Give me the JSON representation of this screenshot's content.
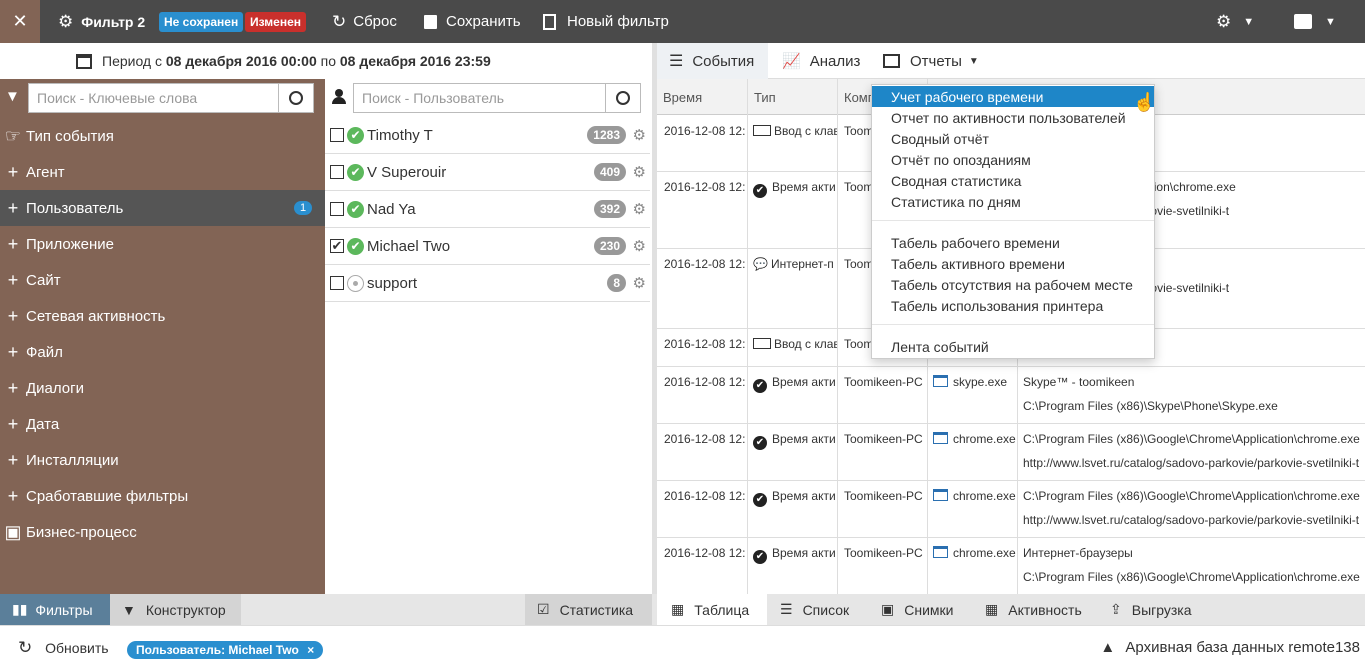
{
  "topbar": {
    "filter_name": "Фильтр 2",
    "badge_unsaved": "Не сохранен",
    "badge_changed": "Изменен",
    "reset_label": "Сброс",
    "save_label": "Сохранить",
    "new_filter_label": "Новый фильтр",
    "badge_unsaved_color": "#2a8fcf",
    "badge_changed_color": "#c9302c"
  },
  "period": {
    "prefix": "Период с",
    "from": "08 декабря 2016 00:00",
    "mid": "по",
    "to": "08 декабря 2016 23:59"
  },
  "search": {
    "keywords_placeholder": "Поиск - Ключевые слова",
    "users_placeholder": "Поиск - Пользователь"
  },
  "categories": [
    {
      "label": "Тип события"
    },
    {
      "label": "Агент"
    },
    {
      "label": "Пользователь",
      "count": "1"
    },
    {
      "label": "Приложение"
    },
    {
      "label": "Сайт"
    },
    {
      "label": "Сетевая активность"
    },
    {
      "label": "Файл"
    },
    {
      "label": "Диалоги"
    },
    {
      "label": "Дата"
    },
    {
      "label": "Инсталляции"
    },
    {
      "label": "Сработавшие фильтры"
    },
    {
      "label": "Бизнес-процесс"
    }
  ],
  "users": [
    {
      "name": "Timothy T",
      "count": "1283",
      "checked": false,
      "online": true
    },
    {
      "name": "V Superouir",
      "count": "409",
      "checked": false,
      "online": true
    },
    {
      "name": "Nad Ya",
      "count": "392",
      "checked": false,
      "online": true
    },
    {
      "name": "Michael Two",
      "count": "230",
      "checked": true,
      "online": true
    },
    {
      "name": "support",
      "count": "8",
      "checked": false,
      "online": false
    }
  ],
  "right_tabs": {
    "events": "События",
    "analysis": "Анализ",
    "reports": "Отчеты"
  },
  "table": {
    "headers": {
      "time": "Время",
      "type": "Тип",
      "comp": "Комп"
    },
    "rows": [
      {
        "time": "2016-12-08 12:",
        "type": "Ввод с клав",
        "comp": "Toom",
        "app": "",
        "detail1": "",
        "detail2": ""
      },
      {
        "time": "2016-12-08 12:",
        "type": "Время акти",
        "comp": "Toom",
        "app": "",
        "detail1": "Google\\Chrome\\Application\\chrome.exe",
        "detail2": "lg/sadovo-parkovie/parkovie-svetilniki-t"
      },
      {
        "time": "2016-12-08 12:",
        "type": "Интернет-п",
        "comp": "Toom",
        "app": "",
        "detail1": "",
        "detail2": "lg/sadovo-parkovie/parkovie-svetilniki-t"
      },
      {
        "time": "2016-12-08 12:",
        "type": "Ввод с клав",
        "comp": "Toom",
        "app": "",
        "detail1": "ники - Google Chrome",
        "detail2": ""
      },
      {
        "time": "2016-12-08 12:",
        "type": "Время акти",
        "comp": "Toomikeen-PC",
        "app": "skype.exe",
        "detail1": "Skype™ - toomikeen",
        "detail2": "C:\\Program Files (x86)\\Skype\\Phone\\Skype.exe"
      },
      {
        "time": "2016-12-08 12:",
        "type": "Время акти",
        "comp": "Toomikeen-PC",
        "app": "chrome.exe",
        "detail1": "C:\\Program Files (x86)\\Google\\Chrome\\Application\\chrome.exe",
        "detail2": "http://www.lsvet.ru/catalog/sadovo-parkovie/parkovie-svetilniki-t"
      },
      {
        "time": "2016-12-08 12:",
        "type": "Время акти",
        "comp": "Toomikeen-PC",
        "app": "chrome.exe",
        "detail1": "C:\\Program Files (x86)\\Google\\Chrome\\Application\\chrome.exe",
        "detail2": "http://www.lsvet.ru/catalog/sadovo-parkovie/parkovie-svetilniki-t"
      },
      {
        "time": "2016-12-08 12:",
        "type": "Время акти",
        "comp": "Toomikeen-PC",
        "app": "chrome.exe",
        "detail1": "Интернет-браузеры",
        "detail2": "C:\\Program Files (x86)\\Google\\Chrome\\Application\\chrome.exe"
      }
    ]
  },
  "reports_menu": {
    "group1": [
      "Учет рабочего времени",
      "Отчет по активности пользователей",
      "Сводный отчёт",
      "Отчёт по опозданиям",
      "Сводная статистика",
      "Статистика по дням"
    ],
    "group2": [
      "Табель рабочего времени",
      "Табель активного времени",
      "Табель отсутствия на рабочем месте",
      "Табель использования принтера"
    ],
    "group3": [
      "Лента событий"
    ]
  },
  "bottom_tabs": {
    "filters": "Фильтры",
    "constructor": "Конструктор",
    "statistics": "Статистика",
    "table": "Таблица",
    "list": "Список",
    "snapshots": "Снимки",
    "activity": "Активность",
    "export": "Выгрузка"
  },
  "status": {
    "refresh": "Обновить",
    "filter_pill": "Пользователь: Michael Two",
    "db_label": "Архивная база данных remote138"
  }
}
